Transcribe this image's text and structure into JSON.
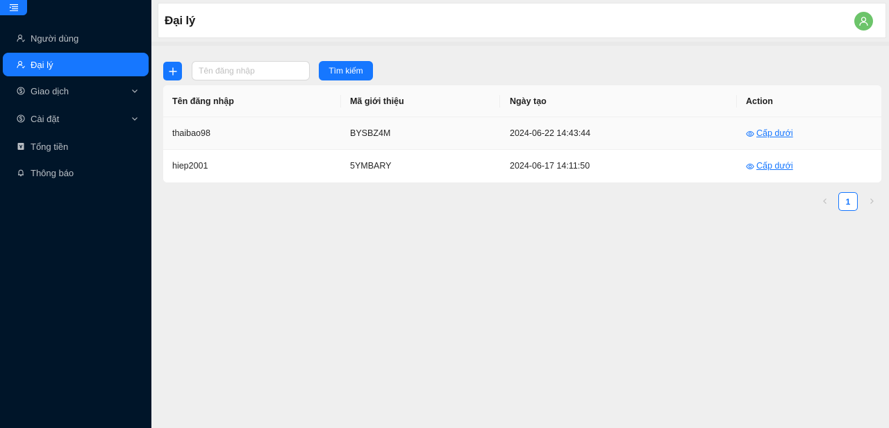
{
  "sidebar": {
    "items": [
      {
        "label": "Người dùng",
        "icon": "user-icon",
        "active": false
      },
      {
        "label": "Đại lý",
        "icon": "user-icon",
        "active": true
      },
      {
        "label": "Giao dịch",
        "icon": "transaction-icon",
        "active": false,
        "expandable": true
      },
      {
        "label": "Cài đặt",
        "icon": "settings-icon",
        "active": false,
        "expandable": true
      },
      {
        "label": "Tổng tiền",
        "icon": "money-icon",
        "active": false
      },
      {
        "label": "Thông báo",
        "icon": "bell-icon",
        "active": false
      }
    ]
  },
  "header": {
    "title": "Đại lý"
  },
  "toolbar": {
    "search_placeholder": "Tên đăng nhập",
    "search_label": "Tìm kiếm"
  },
  "table": {
    "columns": [
      "Tên đăng nhập",
      "Mã giới thiệu",
      "Ngày tạo",
      "Action"
    ],
    "rows": [
      {
        "username": "thaibao98",
        "referral_code": "BYSBZ4M",
        "created_at": "2024-06-22 14:43:44",
        "action": "Cấp dưới"
      },
      {
        "username": "hiep2001",
        "referral_code": "5YMBARY",
        "created_at": "2024-06-17 14:11:50",
        "action": "Cấp dưới"
      }
    ]
  },
  "pagination": {
    "current": "1"
  },
  "colors": {
    "sidebar_bg": "#001529",
    "primary": "#1677ff",
    "avatar": "#6cc46a",
    "content_bg": "#efefef"
  }
}
